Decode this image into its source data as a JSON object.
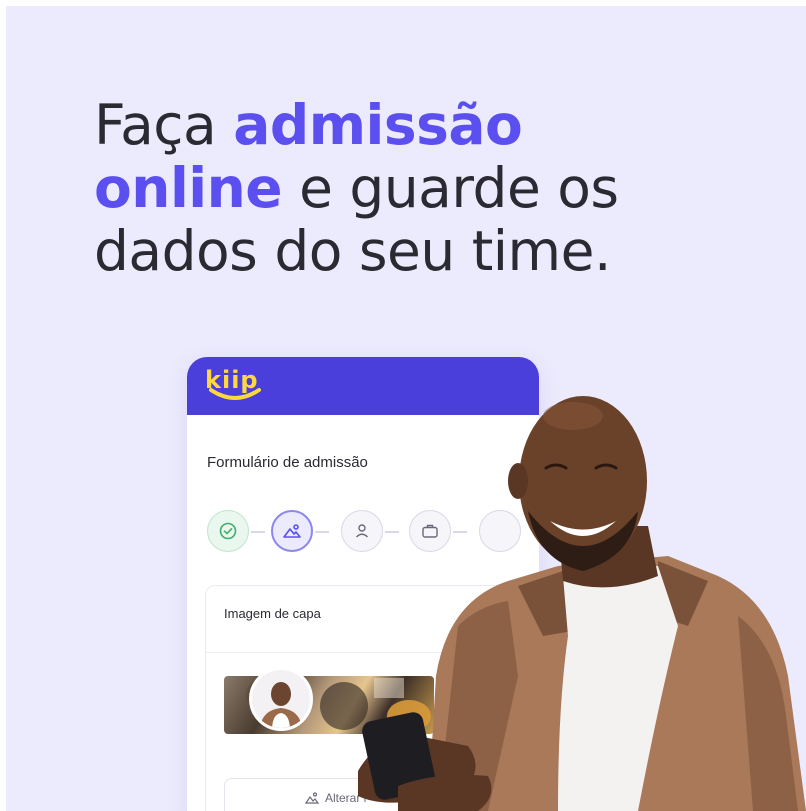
{
  "headline": {
    "part1": "Faça ",
    "accent1": "admissão",
    "accent2": "online",
    "part2": " e guarde os",
    "line3": "dados do seu time."
  },
  "app": {
    "logo": "kiip",
    "form_title": "Formulário de admissão",
    "steps": [
      "check-icon",
      "image-upload-icon",
      "user-icon",
      "briefcase-icon",
      "step-5-icon"
    ],
    "section_title": "Imagem de capa",
    "change_label": "Alterar i"
  },
  "colors": {
    "background": "#ecebfd",
    "accent": "#5b4ff0",
    "header": "#4a3fdb",
    "logo": "#ffd93b"
  }
}
